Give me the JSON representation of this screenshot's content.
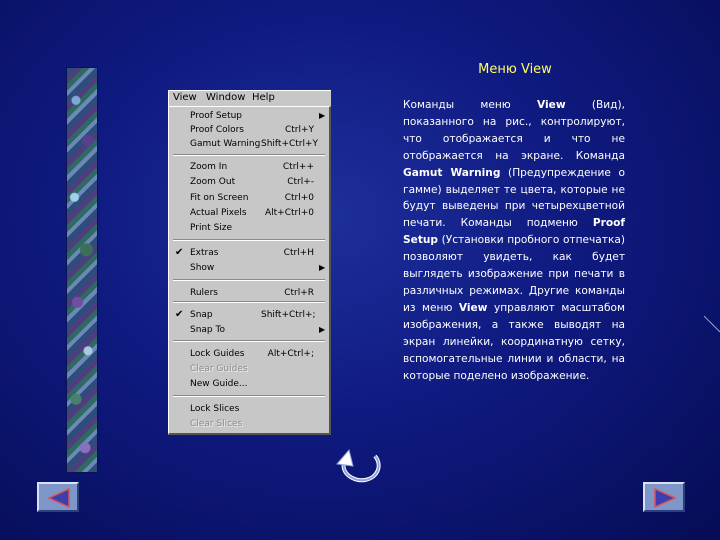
{
  "menubar": {
    "view": "View",
    "window": "Window",
    "help": "Help"
  },
  "menu_items": [
    {
      "label": "Proof Setup",
      "shortcut": "",
      "submenu": true
    },
    {
      "label": "Proof Colors",
      "shortcut": "Ctrl+Y"
    },
    {
      "label": "Gamut Warning",
      "shortcut": "Shift+Ctrl+Y"
    },
    {
      "label": "Zoom In",
      "shortcut": "Ctrl++"
    },
    {
      "label": "Zoom Out",
      "shortcut": "Ctrl+-"
    },
    {
      "label": "Fit on Screen",
      "shortcut": "Ctrl+0"
    },
    {
      "label": "Actual Pixels",
      "shortcut": "Alt+Ctrl+0"
    },
    {
      "label": "Print Size",
      "shortcut": ""
    },
    {
      "label": "Extras",
      "shortcut": "Ctrl+H",
      "checked": true
    },
    {
      "label": "Show",
      "shortcut": "",
      "submenu": true
    },
    {
      "label": "Rulers",
      "shortcut": "Ctrl+R"
    },
    {
      "label": "Snap",
      "shortcut": "Shift+Ctrl+;",
      "checked": true
    },
    {
      "label": "Snap To",
      "shortcut": "",
      "submenu": true
    },
    {
      "label": "Lock Guides",
      "shortcut": "Alt+Ctrl+;"
    },
    {
      "label": "Clear Guides",
      "shortcut": "",
      "disabled": true
    },
    {
      "label": "New Guide...",
      "shortcut": ""
    },
    {
      "label": "Lock Slices",
      "shortcut": ""
    },
    {
      "label": "Clear Slices",
      "shortcut": "",
      "disabled": true
    }
  ],
  "title": "Меню View",
  "paragraph": [
    {
      "t": "Команды меню "
    },
    {
      "b": "View"
    },
    {
      "t": " (Вид), показанного на рис., контролируют, что отображается и что не отображается на экране. Команда "
    },
    {
      "b": "Gamut Warning"
    },
    {
      "t": " (Предупреждение о гамме) выделяет те цвета, которые не будут выведены при четырехцветной печати. Команды подменю "
    },
    {
      "b": "Proof Setup"
    },
    {
      "t": " (Установки пробного отпечатка) позволяют увидеть, как будет выглядеть изображение при печати в различных режимах. Другие команды из меню "
    },
    {
      "b": "View"
    },
    {
      "t": " управляют масштабом изображения, а также выводят на экран линейки, координатную сетку, вспомогательные линии и области, на которые поделено изображение."
    }
  ],
  "icons": {
    "prev": "triangle-left-icon",
    "next": "triangle-right-icon",
    "return": "curved-arrow-icon",
    "check": "checkmark-icon",
    "submenu": "submenu-arrow-icon"
  },
  "colors": {
    "background": "#0f1a80",
    "title": "#ffff66",
    "menu": "#c7c7c7",
    "nav_button": "#7f97c8"
  }
}
